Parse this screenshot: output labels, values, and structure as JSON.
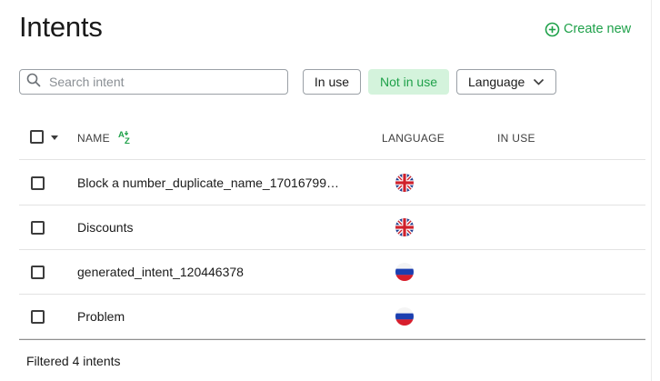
{
  "header": {
    "title": "Intents",
    "create_label": "Create new"
  },
  "toolbar": {
    "search_placeholder": "Search intent",
    "filter_in_use": "In use",
    "filter_not_in_use": "Not in use",
    "language_label": "Language",
    "active_filter": "Not in use"
  },
  "table": {
    "columns": {
      "name": "NAME",
      "language": "LANGUAGE",
      "in_use": "IN USE"
    },
    "rows": [
      {
        "name": "Block a number_duplicate_name_17016799…",
        "flag": "gb-flag-icon"
      },
      {
        "name": "Discounts",
        "flag": "gb-flag-icon"
      },
      {
        "name": "generated_intent_120446378",
        "flag": "ru-flag-icon"
      },
      {
        "name": "Problem",
        "flag": "ru-flag-icon"
      }
    ]
  },
  "footer": {
    "status": "Filtered 4 intents"
  },
  "colors": {
    "accent": "#1fa14a",
    "chip_active_bg": "#d4f3dc",
    "border": "#9aa0a6"
  }
}
